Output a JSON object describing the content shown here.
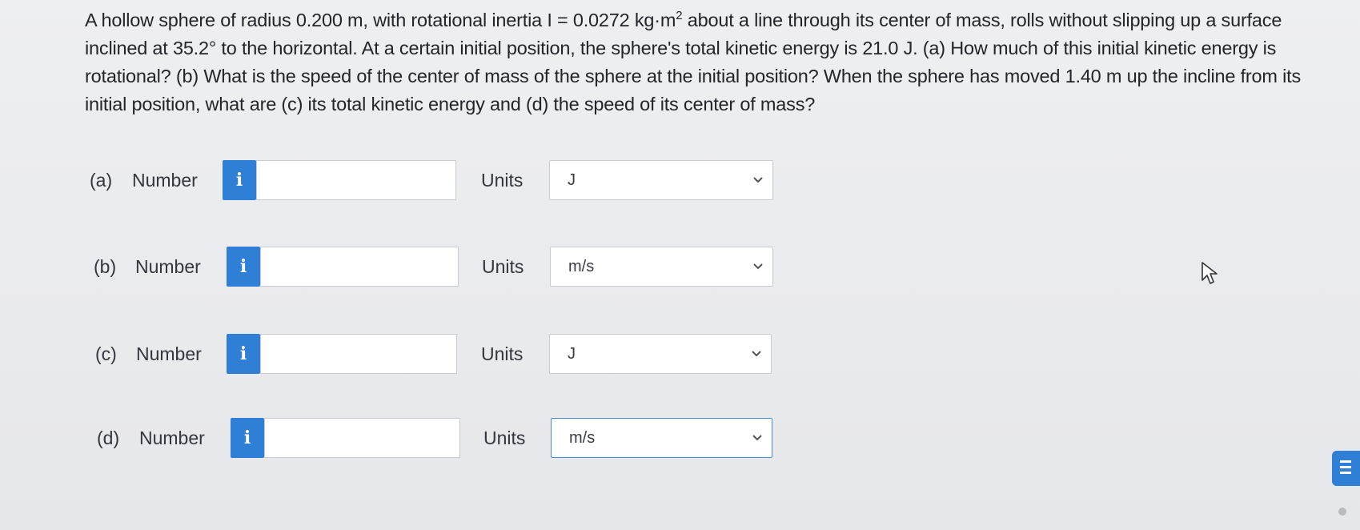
{
  "question": {
    "text_before_sup": "A hollow sphere of radius 0.200 m, with rotational inertia I = 0.0272 kg·m",
    "sup": "2",
    "text_after_sup": " about a line through its center of mass, rolls without slipping up a surface inclined at 35.2° to the horizontal. At a certain initial position, the sphere's total kinetic energy is 21.0 J. (a) How much of this initial kinetic energy is rotational? (b) What is the speed of the center of mass of the sphere at the initial position? When the sphere has moved 1.40 m up the incline from its initial position, what are (c) its total kinetic energy and (d) the speed of its center of mass?"
  },
  "parts": [
    {
      "label": "(a)",
      "number_label": "Number",
      "info_icon": "i",
      "value": "",
      "units_label": "Units",
      "unit": "J"
    },
    {
      "label": "(b)",
      "number_label": "Number",
      "info_icon": "i",
      "value": "",
      "units_label": "Units",
      "unit": "m/s"
    },
    {
      "label": "(c)",
      "number_label": "Number",
      "info_icon": "i",
      "value": "",
      "units_label": "Units",
      "unit": "J"
    },
    {
      "label": "(d)",
      "number_label": "Number",
      "info_icon": "i",
      "value": "",
      "units_label": "Units",
      "unit": "m/s"
    }
  ],
  "icons": {
    "info": "info-icon",
    "dropdown": "chevron-down-icon",
    "cursor": "mouse-pointer-icon",
    "side_tab": "menu-lines-icon"
  },
  "colors": {
    "accent": "#2f7fd6",
    "background": "#e9eaec",
    "input_border": "#c9cbd0"
  }
}
